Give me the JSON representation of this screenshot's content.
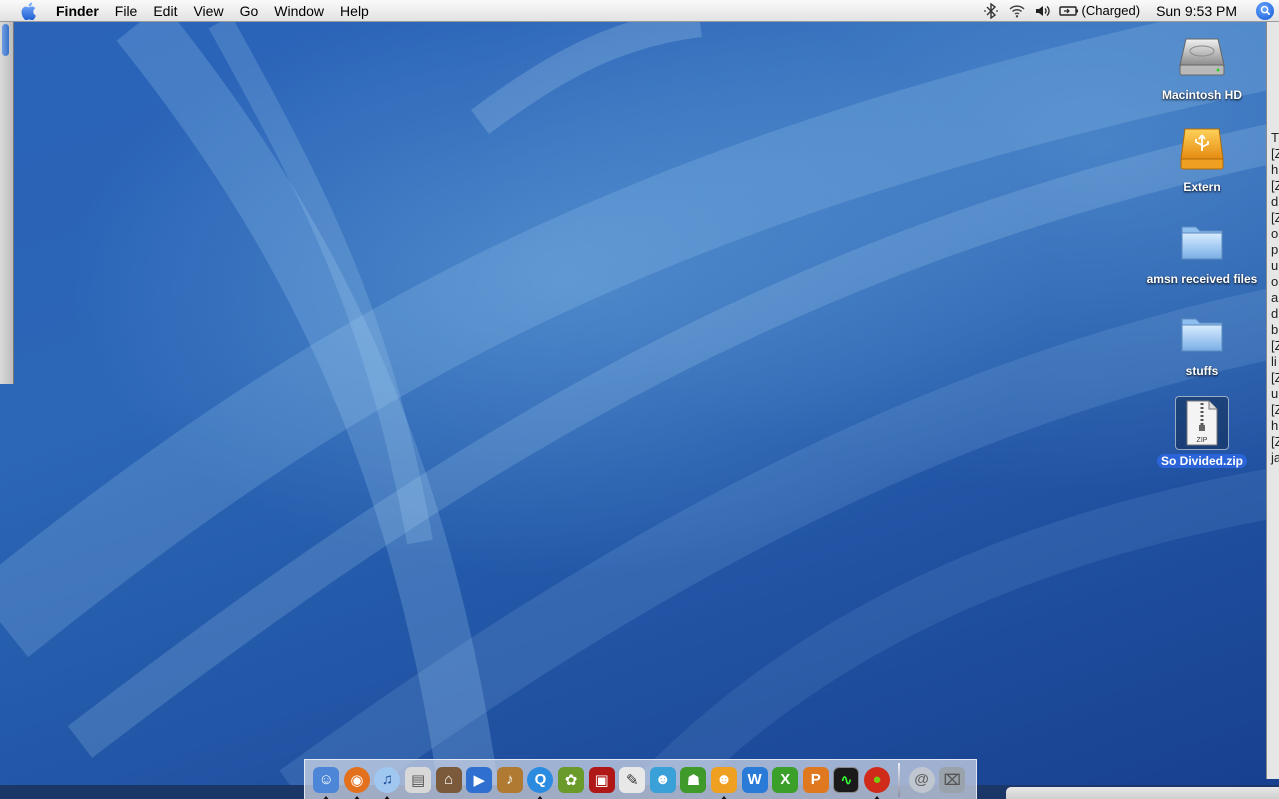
{
  "menubar": {
    "apple_icon": "apple-logo",
    "app_name": "Finder",
    "menus": [
      "File",
      "Edit",
      "View",
      "Go",
      "Window",
      "Help"
    ],
    "status_icons": [
      "bluetooth-icon",
      "wifi-icon",
      "volume-icon",
      "battery-icon"
    ],
    "battery_text": "(Charged)",
    "clock": "Sun 9:53 PM",
    "spotlight_icon": "spotlight-icon"
  },
  "desktop_icons": [
    {
      "label": "Macintosh HD",
      "icon": "hard-drive-icon",
      "selected": false
    },
    {
      "label": "Extern",
      "icon": "usb-drive-icon",
      "selected": false
    },
    {
      "label": "amsn received files",
      "icon": "folder-icon",
      "selected": false
    },
    {
      "label": "stuffs",
      "icon": "folder-icon",
      "selected": false
    },
    {
      "label": "So Divided.zip",
      "icon": "zip-file-icon",
      "selected": true,
      "badge": "ZIP"
    }
  ],
  "right_window_text": [
    "T",
    "[Z",
    "h",
    "[Z",
    "d",
    "[Z",
    "o",
    "p",
    "u",
    "o",
    "a",
    "d",
    "b",
    "[Z",
    "li",
    "[Z",
    "u",
    "[Z",
    "h",
    "[Z",
    "ja"
  ],
  "dock": {
    "apps": [
      {
        "icon": "finder-icon",
        "running": true,
        "color": "#4d86d6",
        "glyph": "☺"
      },
      {
        "icon": "firefox-icon",
        "running": true,
        "color": "#e2701c",
        "glyph": "◉"
      },
      {
        "icon": "itunes-icon",
        "running": true,
        "color": "#9fc7ef",
        "glyph": "♫"
      },
      {
        "icon": "preview-icon",
        "running": false,
        "color": "#d8d8d8",
        "glyph": "▤"
      },
      {
        "icon": "iphoto-icon",
        "running": false,
        "color": "#7a5a3a",
        "glyph": "⌂"
      },
      {
        "icon": "imovie-icon",
        "running": false,
        "color": "#2f6fcf",
        "glyph": "▶"
      },
      {
        "icon": "garageband-icon",
        "running": false,
        "color": "#b07a32",
        "glyph": "♪"
      },
      {
        "icon": "quicktime-icon",
        "running": true,
        "color": "#2a8be0",
        "glyph": "Q"
      },
      {
        "icon": "adium-icon",
        "running": false,
        "color": "#6a9a2a",
        "glyph": "✿"
      },
      {
        "icon": "photo-booth-icon",
        "running": false,
        "color": "#b01818",
        "glyph": "▣"
      },
      {
        "icon": "script-editor-icon",
        "running": false,
        "color": "#e8e8e8",
        "glyph": "✎"
      },
      {
        "icon": "msn-messenger-icon",
        "running": false,
        "color": "#3aa0d8",
        "glyph": "☻"
      },
      {
        "icon": "amsn-icon",
        "running": false,
        "color": "#3f9a2a",
        "glyph": "☗"
      },
      {
        "icon": "messenger-icon",
        "running": true,
        "color": "#f0a020",
        "glyph": "☻"
      },
      {
        "icon": "word-icon",
        "running": false,
        "color": "#2a7ad8",
        "glyph": "W"
      },
      {
        "icon": "excel-icon",
        "running": false,
        "color": "#3aa02a",
        "glyph": "X"
      },
      {
        "icon": "powerpoint-icon",
        "running": false,
        "color": "#e07820",
        "glyph": "P"
      },
      {
        "icon": "activity-monitor-icon",
        "running": false,
        "color": "#1a1a1a",
        "glyph": "∿"
      },
      {
        "icon": "tomato-icon",
        "running": true,
        "color": "#d02a1a",
        "glyph": "●"
      }
    ],
    "extras": [
      {
        "icon": "mail-at-icon",
        "color": "#bfc6cf",
        "glyph": "@"
      },
      {
        "icon": "trash-icon",
        "color": "#9aa2ab",
        "glyph": "⌧"
      }
    ]
  }
}
